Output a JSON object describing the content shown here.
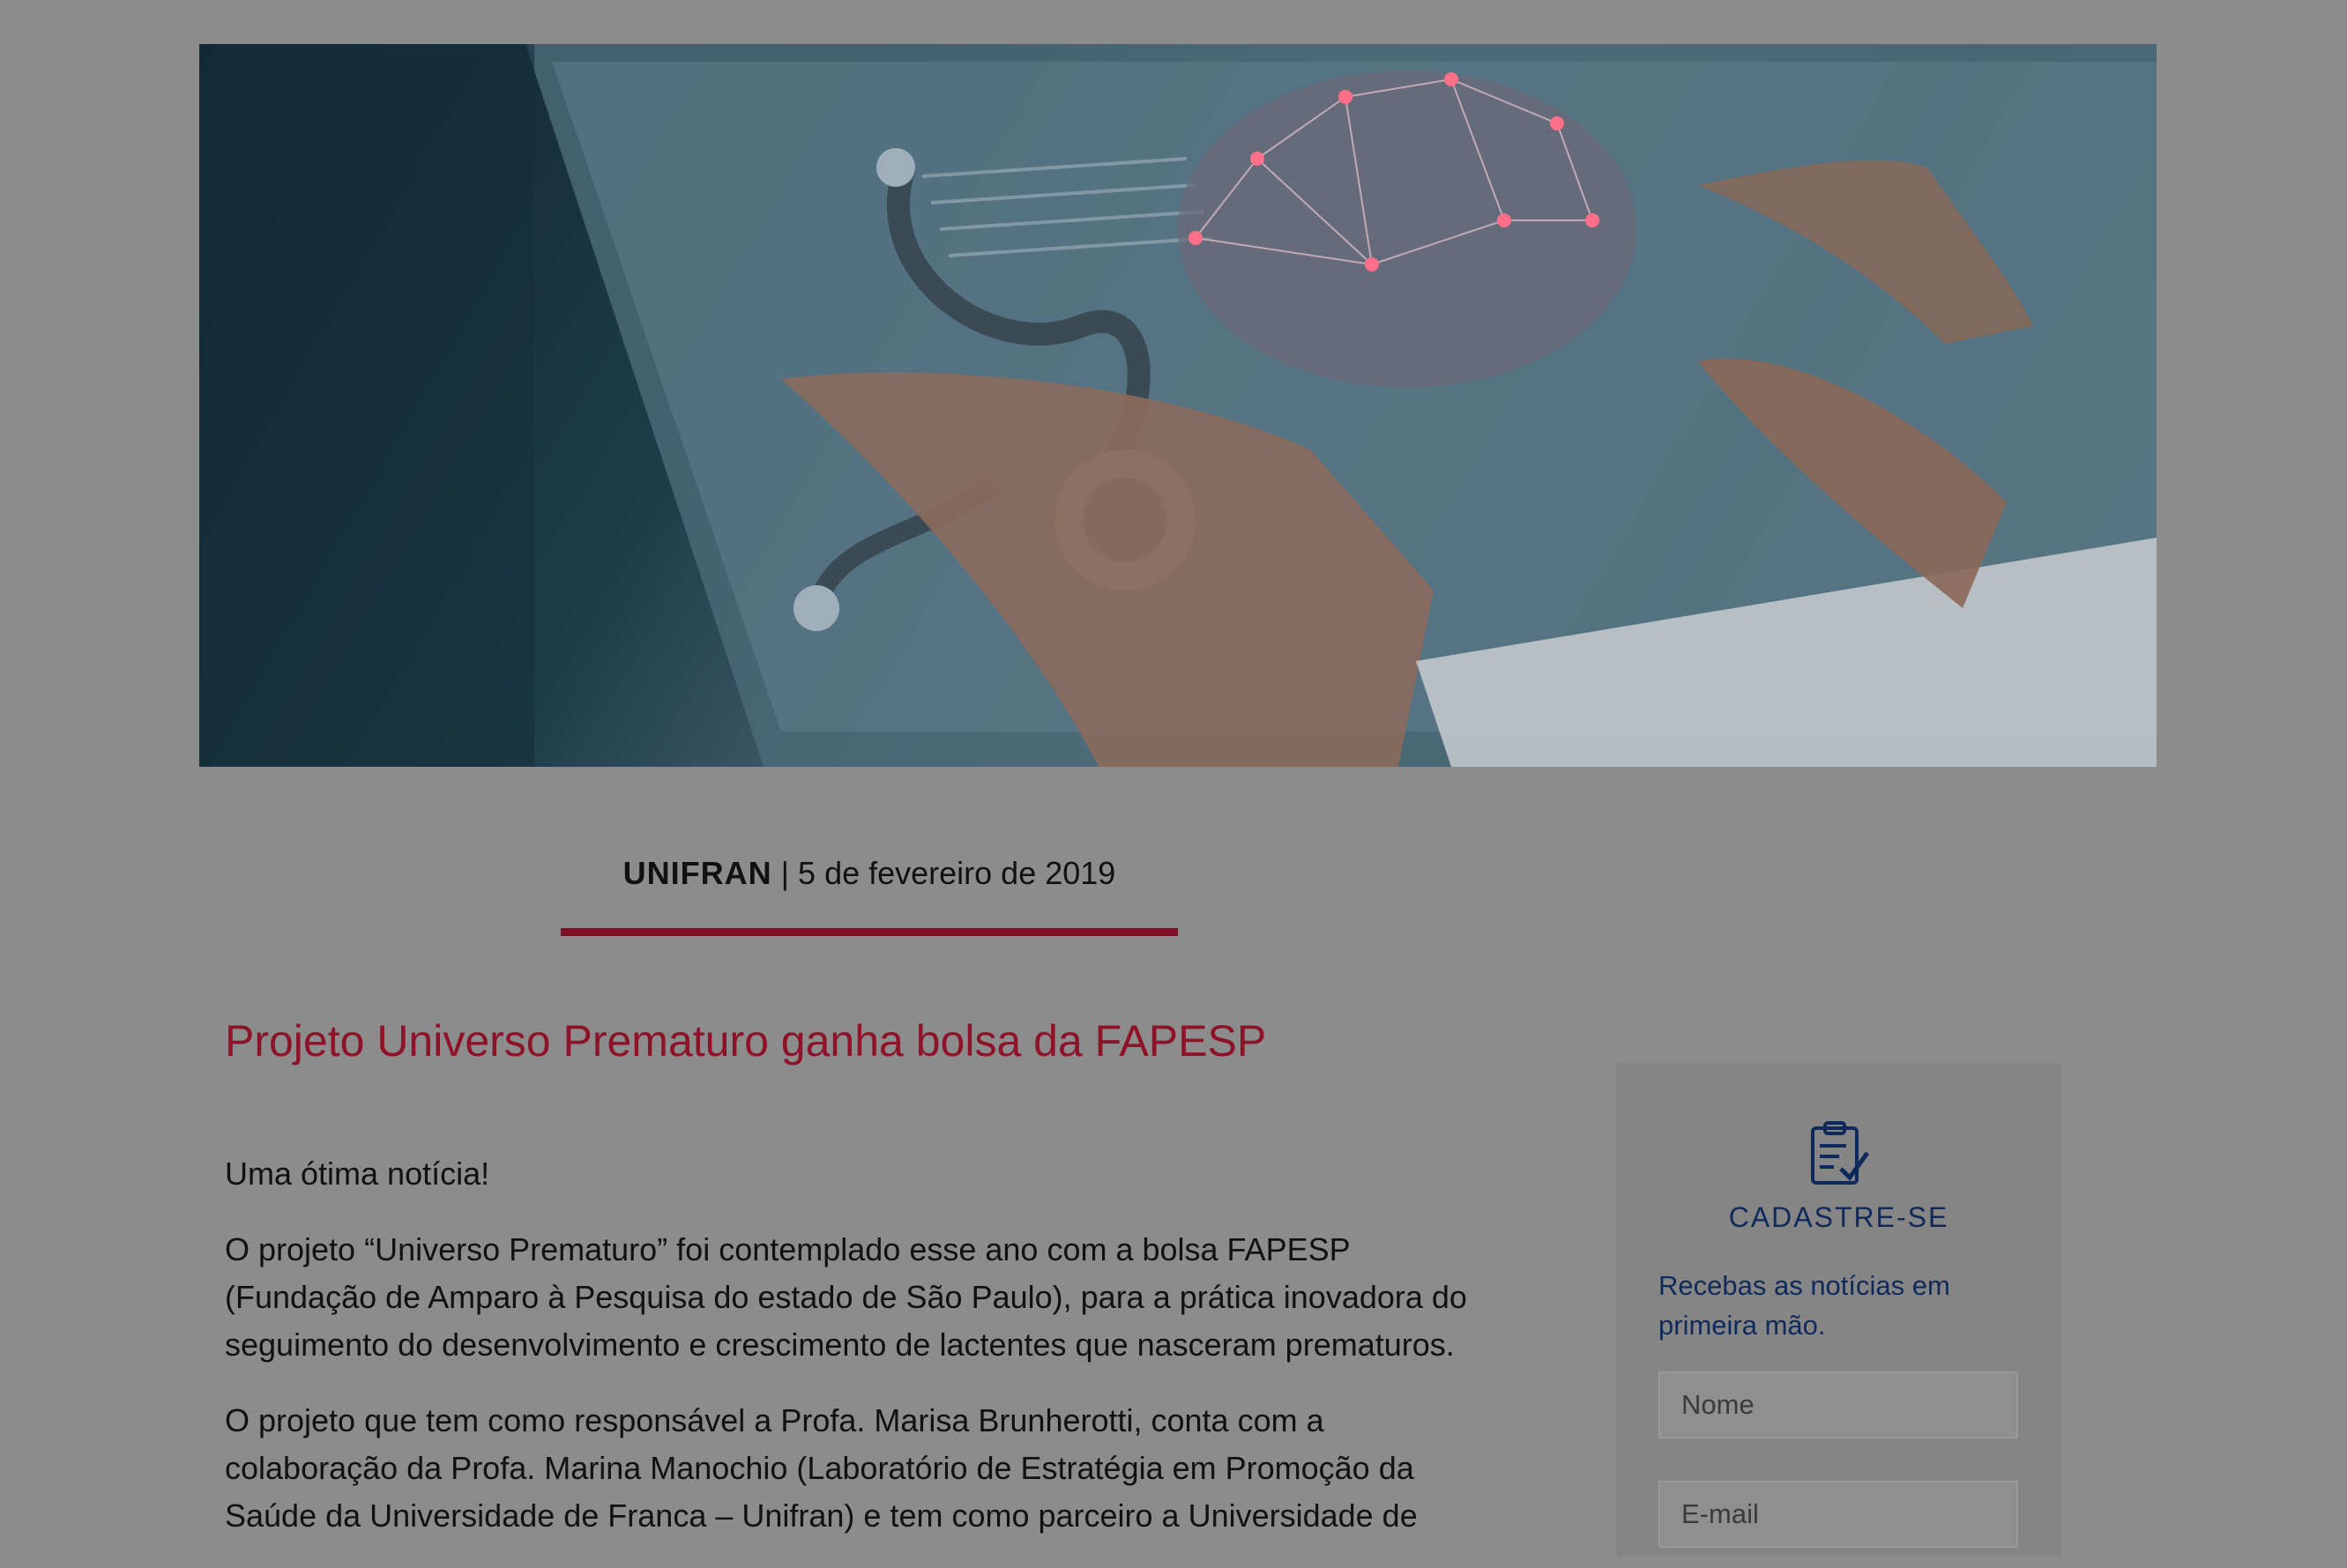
{
  "hero": {
    "icon": "medical-brain-hero-image"
  },
  "meta": {
    "org": "UNIFRAN",
    "separator": "|",
    "date": "5 de fevereiro de 2019"
  },
  "article": {
    "title": "Projeto Universo Prematuro ganha bolsa da FAPESP",
    "paragraphs": [
      "Uma ótima notícia!",
      "O projeto “Universo Prematuro” foi contemplado esse ano com a bolsa FAPESP (Fundação de Amparo à Pesquisa do estado de São Paulo), para a prática inovadora do seguimento do desenvolvimento e crescimento de lactentes que nasceram prematuros.",
      "O projeto que tem como responsável a Profa. Marisa Brunherotti, conta com a colaboração da Profa. Marina Manochio (Laboratório de Estratégia em Promoção da Saúde da Universidade de Franca – Unifran) e tem como parceiro a Universidade de"
    ]
  },
  "signup": {
    "icon": "clipboard-check-icon",
    "title": "CADASTRE-SE",
    "subtitle": "Recebas as notícias em primeira mão.",
    "name_placeholder": "Nome",
    "email_placeholder": "E-mail"
  },
  "colors": {
    "accent": "#7c1026",
    "title": "#8e1228",
    "navy": "#0f2a5a",
    "overlay": "#8c8c8c"
  }
}
